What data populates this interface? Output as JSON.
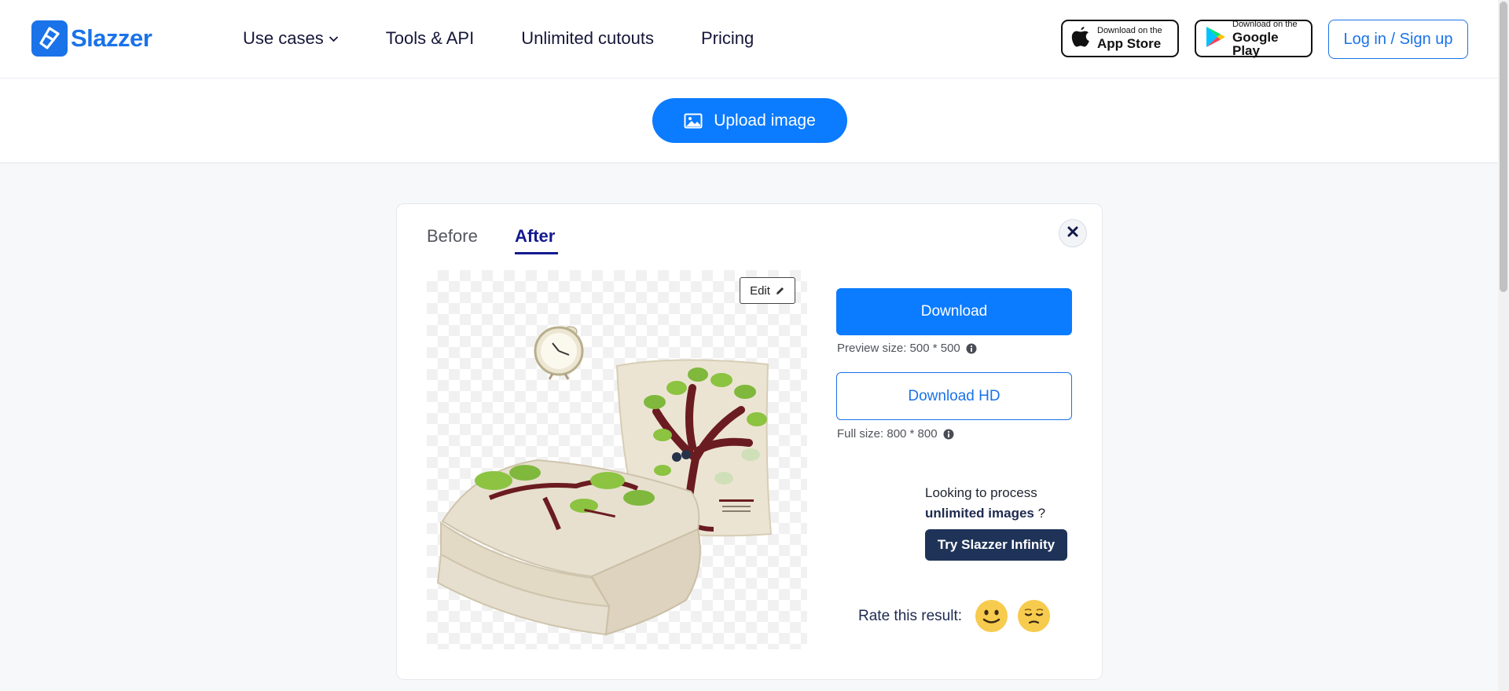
{
  "brand": {
    "name": "Slazzer",
    "color": "#1a73e8"
  },
  "nav": [
    {
      "label": "Use cases",
      "has_dropdown": true
    },
    {
      "label": "Tools & API"
    },
    {
      "label": "Unlimited cutouts"
    },
    {
      "label": "Pricing"
    }
  ],
  "app_store": {
    "small": "Download on the",
    "big": "App Store",
    "icon": "apple-icon"
  },
  "google_play": {
    "small": "Download on the",
    "big": "Google Play",
    "icon": "google-play-icon"
  },
  "login_label": "Log in / Sign up",
  "upload": {
    "label": "Upload image",
    "icon": "image-icon"
  },
  "tabs": [
    {
      "label": "Before",
      "active": false
    },
    {
      "label": "After",
      "active": true
    }
  ],
  "editor": {
    "edit_label": "Edit",
    "edit_icon": "pencil-icon"
  },
  "download": {
    "label": "Download",
    "preview_size": "Preview size: 500 * 500",
    "hd_label": "Download HD",
    "full_size": "Full size: 800 * 800"
  },
  "promo": {
    "line1": "Looking to process",
    "highlight": "unlimited images",
    "suffix": "?",
    "cta": "Try Slazzer Infinity"
  },
  "rating": {
    "label": "Rate this result:",
    "options": [
      "happy-face-icon",
      "disappointed-face-icon"
    ]
  },
  "colors": {
    "primary": "#0b7bff",
    "accent_dark": "#1f3358",
    "active_tab": "#141a8f"
  }
}
